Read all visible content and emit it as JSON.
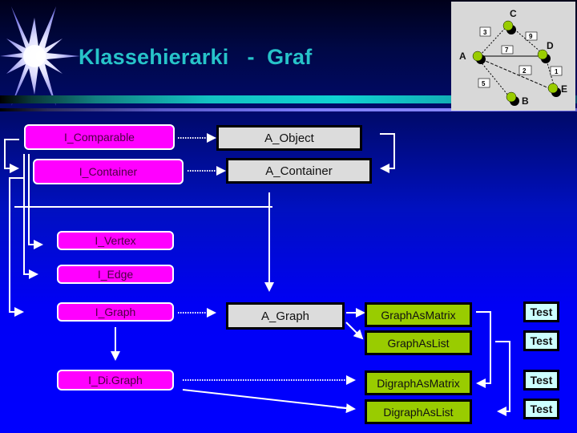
{
  "slide": {
    "title": "Klassehierarki   -  Graf"
  },
  "graph_illustration": {
    "nodes": [
      "A",
      "B",
      "C",
      "D",
      "E"
    ],
    "edges": [
      {
        "from": "A",
        "to": "C",
        "weight": "3"
      },
      {
        "from": "C",
        "to": "D",
        "weight": "9"
      },
      {
        "from": "A",
        "to": "D",
        "weight": "7"
      },
      {
        "from": "A",
        "to": "E",
        "weight": "2"
      },
      {
        "from": "D",
        "to": "E",
        "weight": "1"
      },
      {
        "from": "A",
        "to": "B",
        "weight": "5"
      }
    ],
    "colors": {
      "node": "#99cc00",
      "node_shadow": "#000000",
      "panel": "#d8d8d8"
    }
  },
  "interfaces": {
    "comparable": "I_Comparable",
    "container": "I_Container",
    "vertex": "I_Vertex",
    "edge": "I_Edge",
    "graph": "I_Graph",
    "digraph": "I_Di.Graph"
  },
  "abstract_classes": {
    "object": "A_Object",
    "container": "A_Container",
    "graph": "A_Graph"
  },
  "implementations": {
    "graph_matrix": "GraphAsMatrix",
    "graph_list": "GraphAsList",
    "digraph_matrix": "DigraphAsMatrix",
    "digraph_list": "DigraphAsList"
  },
  "tests": [
    "Test",
    "Test",
    "Test",
    "Test"
  ],
  "colors": {
    "interface": "#ff00ff",
    "abstract": "#dcdcdc",
    "implementation": "#99cc00",
    "test": "#ccffff",
    "title": "#27c3c9",
    "background": "#0000ff"
  }
}
